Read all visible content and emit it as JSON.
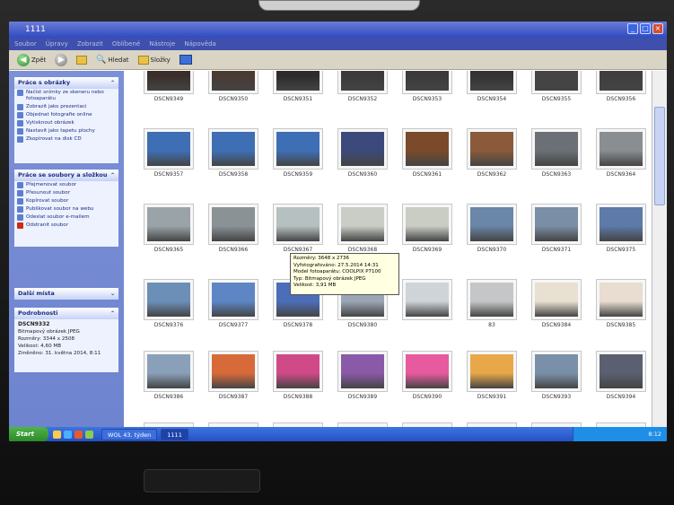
{
  "window": {
    "title": "1111"
  },
  "menu": [
    "Soubor",
    "Úpravy",
    "Zobrazit",
    "Oblíbené",
    "Nástroje",
    "Nápověda"
  ],
  "toolbar": {
    "back": "Zpět",
    "search": "Hledat",
    "folders": "Složky"
  },
  "sidebar": {
    "pictures_panel": {
      "title": "Práce s obrázky",
      "items": [
        "Načíst snímky ze skeneru nebo fotoaparátu",
        "Zobrazit jako prezentaci",
        "Objednat fotografie online",
        "Vytisknout obrázek",
        "Nastavit jako tapetu plochy",
        "Zkopírovat na disk CD"
      ]
    },
    "files_panel": {
      "title": "Práce se soubory a složkou",
      "items": [
        "Přejmenovat soubor",
        "Přesunout soubor",
        "Kopírovat soubor",
        "Publikovat soubor na webu",
        "Odeslat soubor e-mailem",
        "Odstranit soubor"
      ]
    },
    "places_panel": {
      "title": "Další místa"
    },
    "details_panel": {
      "title": "Podrobnosti",
      "name": "DSCN9332",
      "type": "Bitmapový obrázek JPEG",
      "size_dims": "Rozměry: 3344 x 2508",
      "filesize": "Velikost: 4,60 MB",
      "modified": "Změněno: 31. května 2014, 8:11"
    }
  },
  "files": [
    {
      "row": 0,
      "items": [
        "DSCN9349",
        "DSCN9350",
        "DSCN9351",
        "DSCN9352",
        "DSCN9353",
        "DSCN9354",
        "DSCN9355",
        "DSCN9356"
      ]
    },
    {
      "row": 1,
      "items": [
        "DSCN9357",
        "DSCN9358",
        "DSCN9359",
        "DSCN9360",
        "DSCN9361",
        "DSCN9362",
        "DSCN9363",
        "DSCN9364"
      ]
    },
    {
      "row": 2,
      "items": [
        "DSCN9365",
        "DSCN9366",
        "DSCN9367",
        "DSCN9368",
        "DSCN9369",
        "DSCN9370",
        "DSCN9371",
        "DSCN9375"
      ]
    },
    {
      "row": 3,
      "items": [
        "DSCN9376",
        "DSCN9377",
        "DSCN9378",
        "DSCN9380",
        "",
        "83",
        "DSCN9384",
        "DSCN9385"
      ]
    },
    {
      "row": 4,
      "items": [
        "DSCN9386",
        "DSCN9387",
        "DSCN9388",
        "DSCN9389",
        "DSCN9390",
        "DSCN9391",
        "DSCN9393",
        "DSCN9394"
      ]
    }
  ],
  "tooltip": {
    "lines": [
      "Rozměry: 3648 x 2736",
      "Vyfotografováno: 27.5.2014 14:31",
      "Model fotoaparátu: COOLPIX P7100",
      "Typ: Bitmapový obrázek JPEG",
      "Velikost: 3,91 MB"
    ]
  },
  "taskbar": {
    "start": "Start",
    "tasks": [
      "WOL 43. týden",
      "1111"
    ],
    "clock": "8:12"
  },
  "colors": {
    "sidebar": "#7b90d6",
    "taskbar": "#2452c8",
    "start": "#2d8a2a",
    "tooltip_bg": "#ffffe1"
  },
  "thumb_palettes": [
    [
      "#3a2d2a",
      "#4a3a32",
      "#2b2b2b",
      "#3a3a3a",
      "#3a3a3a",
      "#333",
      "#444",
      "#3f3f3f"
    ],
    [
      "#3e6fb5",
      "#3e6fb5",
      "#3e6fb5",
      "#3b4a7a",
      "#7a4a2a",
      "#8a5a3a",
      "#6a7076",
      "#8a8e90"
    ],
    [
      "#9aa4a8",
      "#8a9296",
      "#b7c0c0",
      "#c9cdc6",
      "#c9cdc4",
      "#6a86a8",
      "#7a8ea6",
      "#5d7aa8"
    ],
    [
      "#6c8fb8",
      "#5e86c5",
      "#4c6eb8",
      "#9aa6b4",
      "#cfd4d8",
      "#c4c6c8",
      "#e8e0d0",
      "#e8ddd0"
    ],
    [
      "#8aa0b8",
      "#d86a3a",
      "#d04a88",
      "#8a5aa8",
      "#e85aa0",
      "#e8a84a",
      "#7a90a8",
      "#5a6070"
    ]
  ]
}
